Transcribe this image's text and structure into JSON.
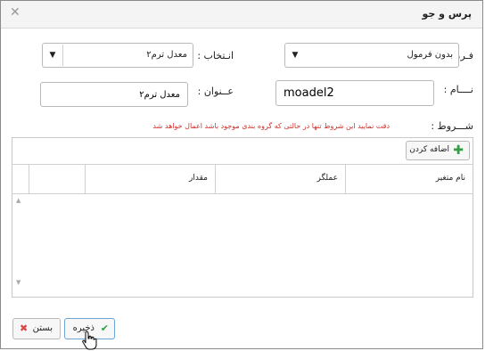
{
  "dialog": {
    "title": "پرس و جو",
    "close_glyph": "✕"
  },
  "form": {
    "formula_label": "فـرمول :",
    "formula_value": "بدون فرمول",
    "select_label": "انـتخاب :",
    "select_value": "معدل ترم۲",
    "name_label": "نــــام :",
    "name_value": "moadel2",
    "title_label": "عــنوان :",
    "title_value": "معدل ترم۲",
    "dropdown_glyph": "▼"
  },
  "conditions": {
    "label": "شـــروط :",
    "warning": "دقت نمایید این شروط تنها در حالتی که گروه بندی موجود باشد اعمال خواهد شد",
    "add_label": "اضافه کردن",
    "columns": [
      "نام متغیر",
      "عملگر",
      "مقدار"
    ]
  },
  "footer": {
    "save_label": "ذخیره",
    "close_label": "بستن"
  }
}
